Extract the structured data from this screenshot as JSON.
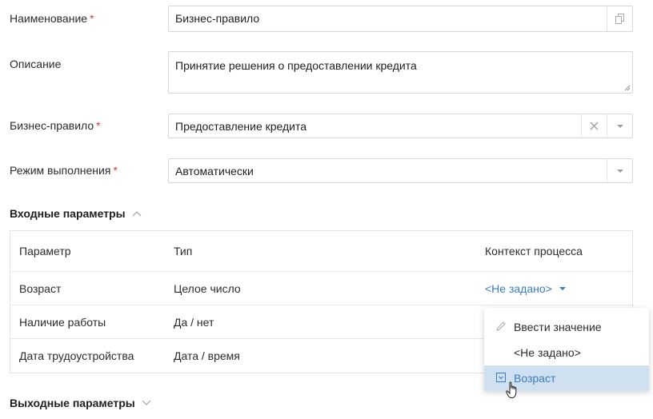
{
  "form": {
    "name": {
      "label": "Наименование",
      "required_mark": "*",
      "value": "Бизнес-правило",
      "copy_icon": "copy-icon"
    },
    "description": {
      "label": "Описание",
      "value": "Принятие решения о предоставлении кредита"
    },
    "business_rule": {
      "label": "Бизнес-правило",
      "required_mark": "*",
      "value": "Предоставление кредита",
      "clear_icon": "close-icon",
      "dropdown_icon": "chevron-down-icon"
    },
    "execution_mode": {
      "label": "Режим выполнения",
      "required_mark": "*",
      "value": "Автоматически",
      "dropdown_icon": "chevron-down-icon"
    }
  },
  "input_params": {
    "title": "Входные параметры",
    "expanded": true,
    "headers": [
      "Параметр",
      "Тип",
      "Контекст процесса"
    ],
    "rows": [
      {
        "param": "Возраст",
        "type": "Целое число",
        "context": "<Не задано>"
      },
      {
        "param": "Наличие работы",
        "type": "Да / нет",
        "context": ""
      },
      {
        "param": "Дата трудоустройства",
        "type": "Дата / время",
        "context": ""
      }
    ]
  },
  "context_dropdown": {
    "items": [
      {
        "label": "Ввести значение",
        "icon": "pencil-icon",
        "selected": false
      },
      {
        "label": "<Не задано>",
        "icon": "",
        "selected": false
      },
      {
        "label": "Возраст",
        "icon": "parameter-icon",
        "selected": true
      }
    ]
  },
  "output_params": {
    "title": "Выходные параметры",
    "expanded": false
  },
  "colors": {
    "accent": "#3a7cc0",
    "required": "#d93a3a",
    "selected_bg": "#cfe0f1",
    "border": "#d5d9dd"
  }
}
